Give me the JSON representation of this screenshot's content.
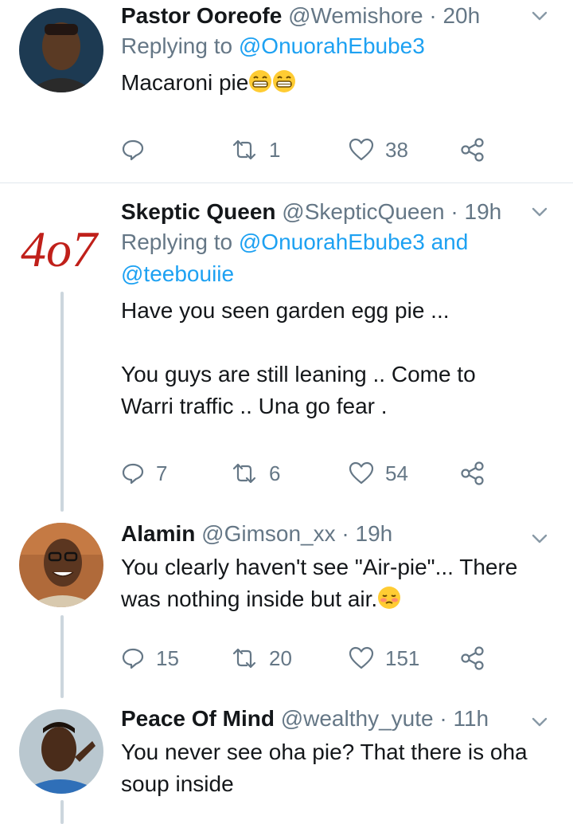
{
  "tweets": [
    {
      "name": "Pastor Ooreofe",
      "handle": "@Wemishore",
      "time": "· 20h",
      "replying_prefix": "Replying to",
      "replying_to": "@OnuorahEbube3",
      "text": "Macaroni pie",
      "reply_count": "",
      "retweet_count": "1",
      "like_count": "38"
    },
    {
      "name": "Skeptic Queen",
      "handle": "@SkepticQueen",
      "time": "· 19h",
      "replying_prefix": "Replying to",
      "replying_to": "@OnuorahEbube3 and",
      "replying_to_2": "@teebouiie",
      "text_line1": "Have you seen garden egg pie ...",
      "text_line2": "You guys are still leaning .. Come to",
      "text_line3": "Warri traffic .. Una go fear .",
      "avatar_text": "4o7",
      "reply_count": "7",
      "retweet_count": "6",
      "like_count": "54"
    },
    {
      "name": "Alamin",
      "handle": "@Gimson_xx",
      "time": "· 19h",
      "text_line1": "You clearly haven't see \"Air-pie\"... There",
      "text_line2": "was nothing inside but air.",
      "reply_count": "15",
      "retweet_count": "20",
      "like_count": "151"
    },
    {
      "name": "Peace Of Mind",
      "handle": "@wealthy_yute",
      "time": "· 11h",
      "text_line1": "You never see oha pie? That there is oha",
      "text_line2": "soup inside"
    }
  ],
  "colors": {
    "link": "#1da1f2",
    "muted": "#657786",
    "divider": "#e1e8ed",
    "thread": "#ccd6dd"
  }
}
